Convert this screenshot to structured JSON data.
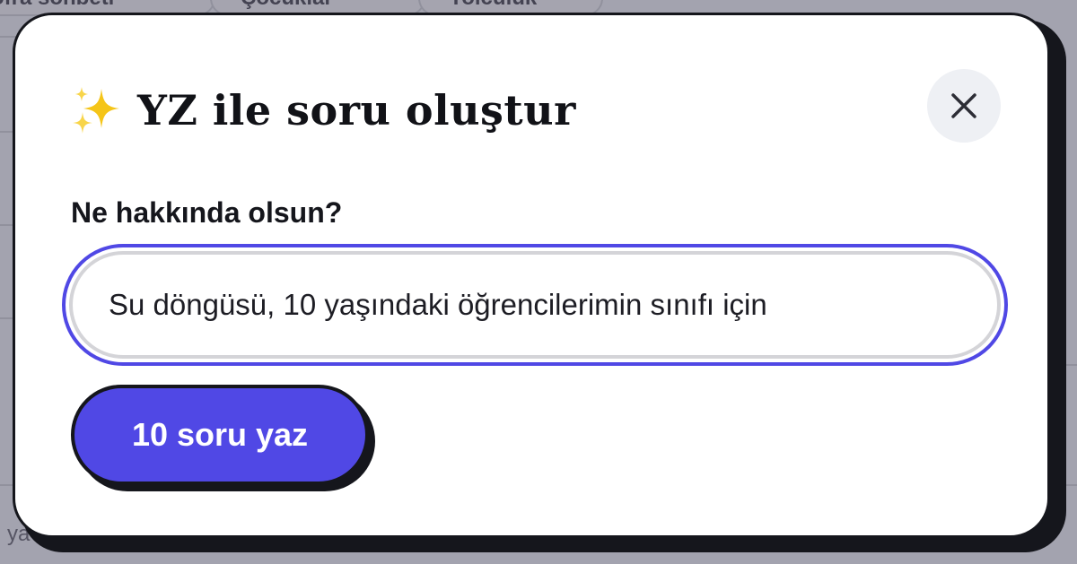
{
  "background": {
    "tabs": [
      "Sofra sohbeti",
      "Çocuklar",
      "Yolculuk"
    ],
    "bottom_text": "ya"
  },
  "modal": {
    "title": "YZ ile soru oluştur",
    "title_icon": "sparkles-icon",
    "close_icon": "close-icon",
    "field_label": "Ne hakkında olsun?",
    "topic_input": {
      "value": "Su döngüsü, 10 yaşındaki öğrencilerimin sınıfı için",
      "placeholder": ""
    },
    "generate_button_label": "10 soru yaz"
  },
  "colors": {
    "accent": "#5048e5",
    "ink": "#15161c",
    "close_bg": "#eef0f4",
    "sparkle": "#f5c518"
  }
}
